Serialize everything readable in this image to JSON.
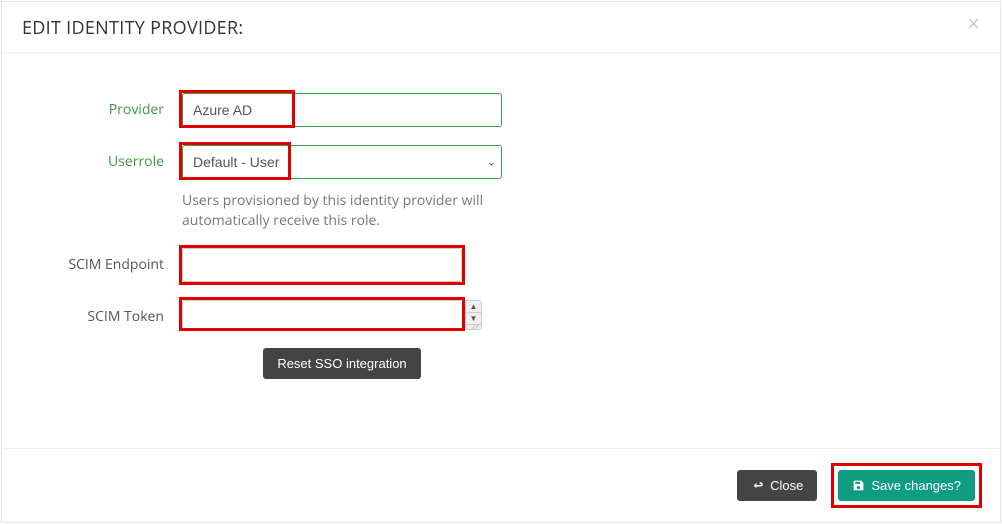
{
  "header": {
    "title": "EDIT IDENTITY PROVIDER:",
    "close_symbol": "×"
  },
  "form": {
    "provider": {
      "label": "Provider",
      "value": "Azure AD"
    },
    "userrole": {
      "label": "Userrole",
      "selected": "Default - User",
      "help": "Users provisioned by this identity provider will automatically receive this role."
    },
    "scim_endpoint": {
      "label": "SCIM Endpoint",
      "value": ""
    },
    "scim_token": {
      "label": "SCIM Token",
      "value": ""
    },
    "reset_button": "Reset SSO integration"
  },
  "footer": {
    "close": "Close",
    "save": "Save changes?"
  }
}
